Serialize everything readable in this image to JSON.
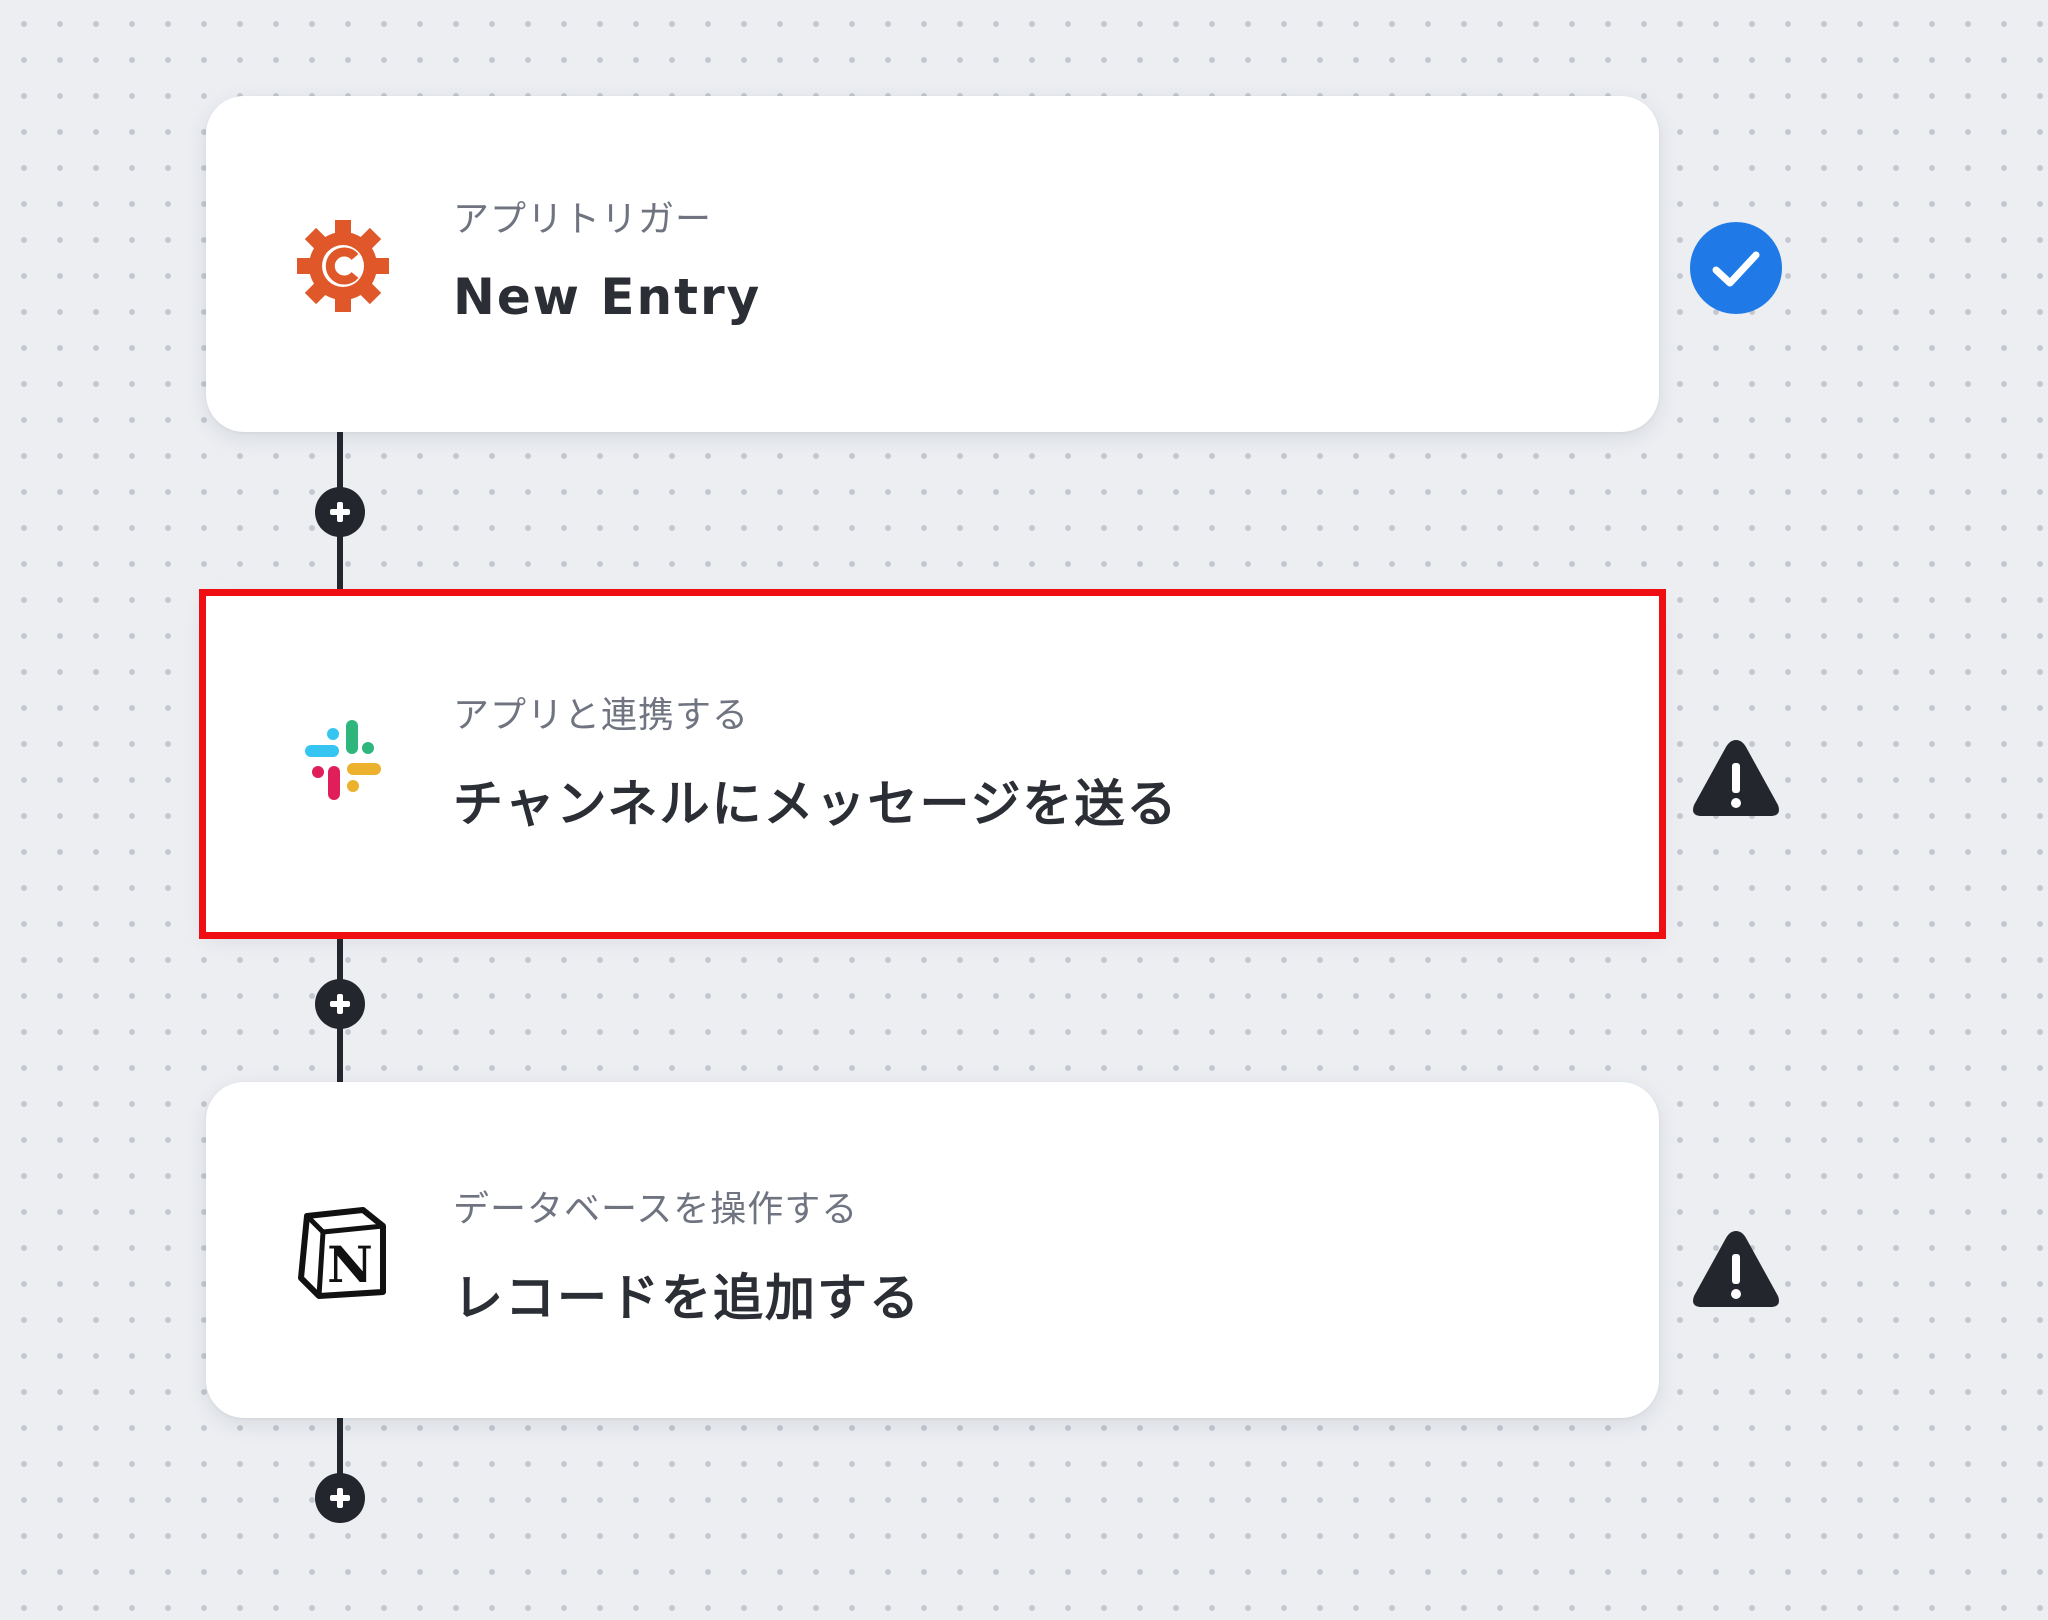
{
  "flow": {
    "steps": [
      {
        "category": "アプリトリガー",
        "title": "New Entry",
        "app_icon": "cognito-forms-gear-icon",
        "status": "completed",
        "status_icon": "check-circle-icon",
        "highlighted": false
      },
      {
        "category": "アプリと連携する",
        "title": "チャンネルにメッセージを送る",
        "app_icon": "slack-icon",
        "status": "warning",
        "status_icon": "warning-triangle-icon",
        "highlighted": true
      },
      {
        "category": "データベースを操作する",
        "title": "レコードを追加する",
        "app_icon": "notion-icon",
        "status": "warning",
        "status_icon": "warning-triangle-icon",
        "highlighted": false
      }
    ],
    "add_step_icon": "plus-icon"
  },
  "colors": {
    "canvas_background": "#eceef2",
    "dot_grid": "#c3c7cf",
    "card_background": "#ffffff",
    "connector": "#23262d",
    "highlight_border": "#ef0f12",
    "check_blue": "#1f7ae8",
    "warning_dark": "#23262d",
    "cognito_orange": "#e0582a",
    "category_text": "#6f7480",
    "title_text": "#2b2e35"
  }
}
